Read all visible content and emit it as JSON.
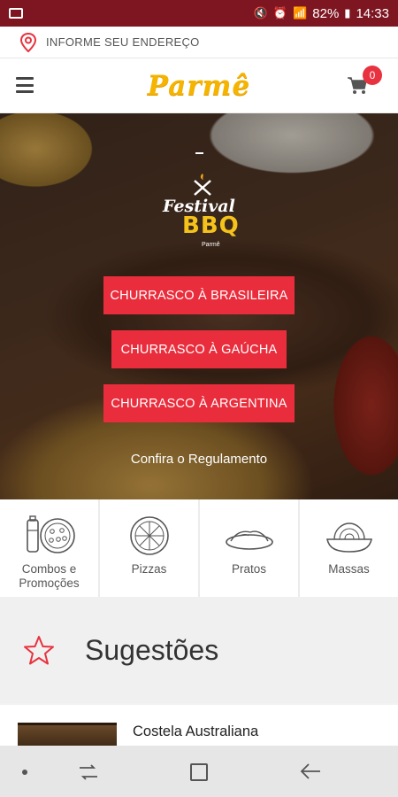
{
  "status_bar": {
    "battery": "82%",
    "time": "14:33"
  },
  "address": {
    "placeholder": "INFORME SEU ENDEREÇO"
  },
  "header": {
    "logo": "Parmê",
    "cart_count": "0"
  },
  "hero": {
    "banner": {
      "festival": "Festival",
      "bbq": "BBQ",
      "brand": "Parmê"
    },
    "buttons": [
      "CHURRASCO À BRASILEIRA",
      "CHURRASCO À GAÚCHA",
      "CHURRASCO À ARGENTINA"
    ],
    "regulation_link": "Confira o Regulamento"
  },
  "categories": [
    {
      "label": "Combos e Promoções",
      "icon": "combo-icon"
    },
    {
      "label": "Pizzas",
      "icon": "pizza-icon"
    },
    {
      "label": "Pratos",
      "icon": "plate-icon"
    },
    {
      "label": "Massas",
      "icon": "pasta-icon"
    }
  ],
  "suggestions": {
    "title": "Sugestões",
    "items": [
      {
        "name": "Costela Australiana"
      }
    ]
  },
  "colors": {
    "status_bar": "#7d1621",
    "accent": "#ea2d3c",
    "logo": "#f5b400"
  }
}
